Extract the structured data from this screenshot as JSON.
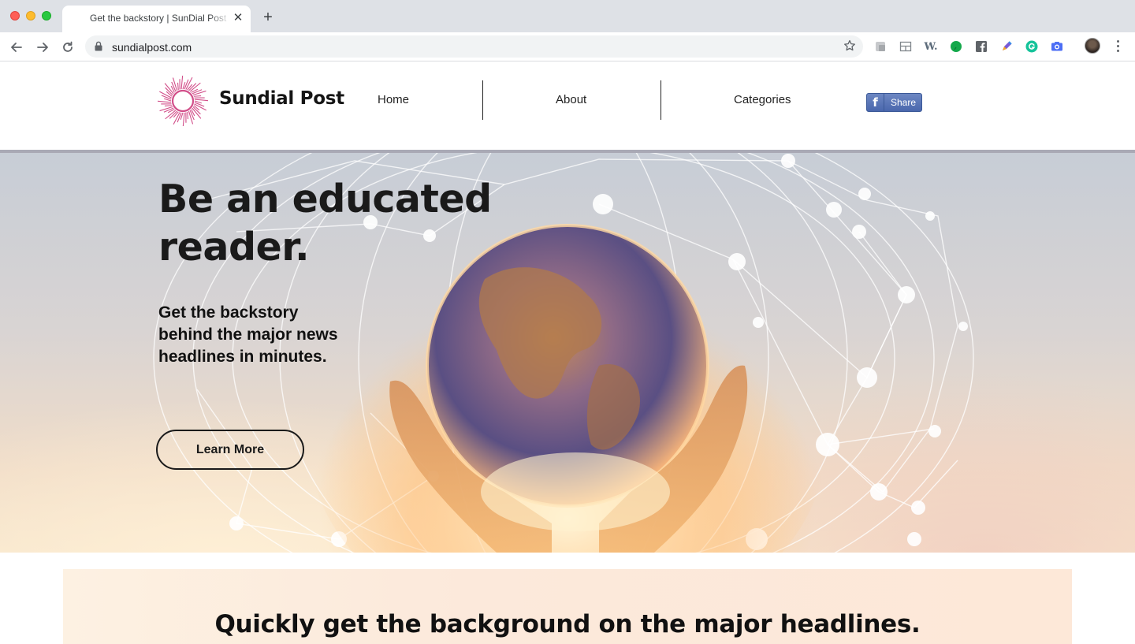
{
  "browser": {
    "tab_title": "Get the backstory | SunDial Post",
    "url": "sundialpost.com",
    "extensions": [
      "grey-square-icon",
      "layout-icon",
      "w-dot-icon",
      "evernote-icon",
      "facebook-square-icon",
      "pen-icon",
      "grammarly-icon",
      "camera-icon"
    ]
  },
  "site": {
    "brand": "Sundial Post",
    "nav": {
      "home": "Home",
      "about": "About",
      "categories": "Categories"
    },
    "share_label": "Share"
  },
  "hero": {
    "title_line1": "Be an educated",
    "title_line2": "reader.",
    "subtitle_line1": "Get the backstory",
    "subtitle_line2": "behind the major news",
    "subtitle_line3": "headlines in minutes.",
    "cta": "Learn More"
  },
  "section": {
    "title": "Quickly get the background on the major headlines."
  },
  "colors": {
    "logo_pink": "#d24f8a",
    "facebook_blue": "#4a67ad",
    "text_dark": "#1a1a1a"
  }
}
